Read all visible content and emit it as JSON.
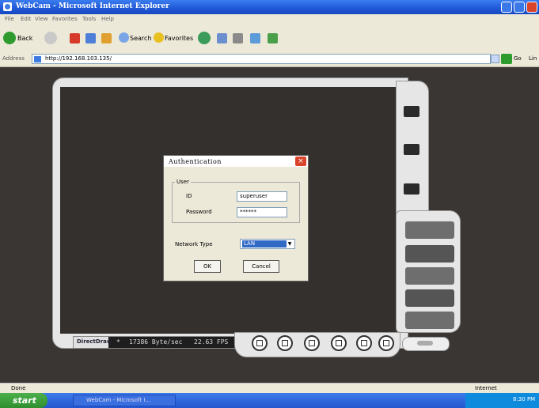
{
  "window": {
    "title": "WebCam - Microsoft Internet Explorer"
  },
  "menu": [
    "File",
    "Edit",
    "View",
    "Favorites",
    "Tools",
    "Help"
  ],
  "toolbar": {
    "back_label": "Back",
    "search_label": "Search",
    "favorites_label": "Favorites"
  },
  "address": {
    "label": "Address",
    "url": "http://192.168.103.135/",
    "go_label": "Go",
    "links_label": "Lin"
  },
  "viewer": {
    "mode_label": "DirectDraw",
    "bitrate": "17386 Byte/sec",
    "fps": "22.63 FPS",
    "star": "*"
  },
  "dialog": {
    "title": "Authentication",
    "close": "×",
    "group_label": "User",
    "id_label": "ID",
    "id_value": "superuser",
    "password_label": "Password",
    "password_value": "******",
    "network_label": "Network Type",
    "network_value": "LAN",
    "ok_label": "OK",
    "cancel_label": "Cancel"
  },
  "statusbar": {
    "left": "Done",
    "zone": "Internet"
  },
  "taskbar": {
    "start_label": "start",
    "task_label": "WebCam - Microsoft I...",
    "clock": "8:30 PM"
  },
  "icons": [
    "ie-icon",
    "back-arrow-icon",
    "forward-arrow-icon",
    "stop-icon",
    "refresh-icon",
    "home-icon",
    "search-icon",
    "favorites-star-icon",
    "history-icon",
    "mail-icon",
    "print-icon",
    "messenger-icon"
  ]
}
